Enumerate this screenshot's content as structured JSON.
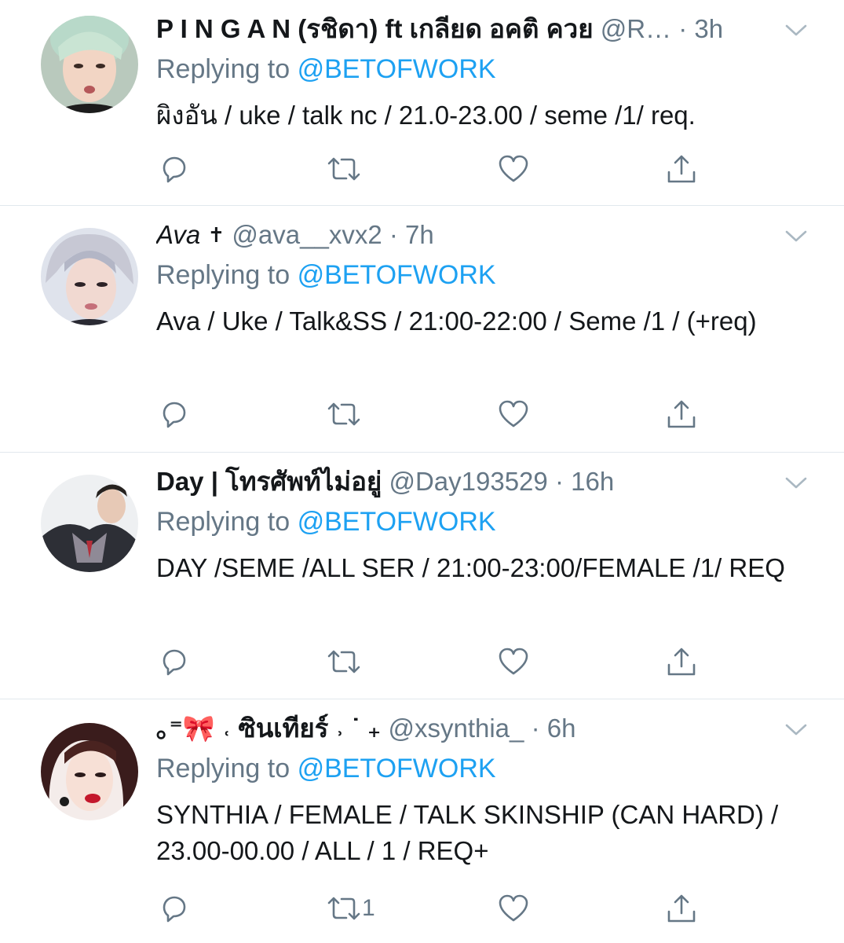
{
  "tweets": [
    {
      "display_name": "P I N G A N (รชิดา) ft เกลียด อคติ ควย",
      "handle": "@R…",
      "time": "3h",
      "replying_prefix": "Replying to",
      "replying_to": "@BETOFWORK",
      "text": "ผิงอัน / uke / talk nc / 21.0-23.00 / seme /1/ req.",
      "retweet_count": "",
      "avatar": "avatar-young-man-green-hair"
    },
    {
      "display_name": "Ava",
      "name_badge": "✝",
      "handle": "@ava__xvx2",
      "time": "7h",
      "replying_prefix": "Replying to",
      "replying_to": "@BETOFWORK",
      "text": "Ava / Uke / Talk&SS / 21:00-22:00 / Seme /1 / (+req)",
      "retweet_count": "",
      "avatar": "avatar-silver-hair-person"
    },
    {
      "display_name": "Day | โทรศัพท์ไม่อยู่",
      "handle": "@Day193529",
      "time": "16h",
      "replying_prefix": "Replying to",
      "replying_to": "@BETOFWORK",
      "text": "DAY /SEME /ALL SER / 21:00-23:00/FEMALE /1/ REQ",
      "retweet_count": "",
      "avatar": "avatar-man-in-suit"
    },
    {
      "display_name": "｡⁼🎀 ˓ ซินเทียร์ ˒ ˙ ₊",
      "handle": "@xsynthia_",
      "time": "6h",
      "replying_prefix": "Replying to",
      "replying_to": "@BETOFWORK",
      "text": "SYNTHIA / FEMALE / TALK SKINSHIP (CAN HARD) / 23.00-00.00 / ALL / 1 / REQ+",
      "retweet_count": "1",
      "avatar": "avatar-woman-red-lips"
    }
  ],
  "colors": {
    "link": "#1da1f2",
    "secondary_text": "#657786",
    "divider": "#e1e8ed",
    "action_icon": "#657786",
    "caret": "#aab8c2"
  }
}
